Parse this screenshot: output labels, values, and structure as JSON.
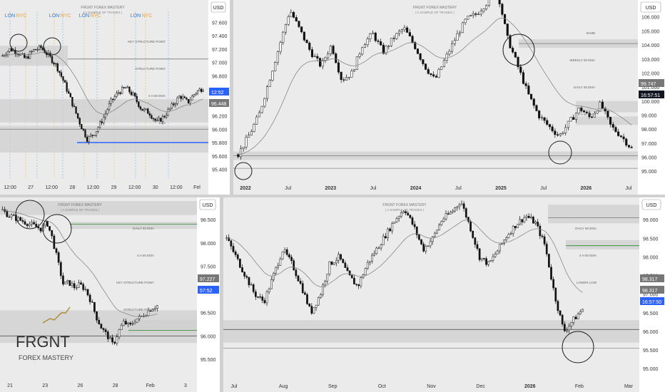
{
  "chart_data": [
    {
      "type": "candlestick",
      "currency": "USD",
      "yticks": [
        "97.600",
        "97.400",
        "97.200",
        "97.000",
        "96.800",
        "96.600",
        "96.400",
        "96.200",
        "96.000",
        "95.800",
        "95.600",
        "95.400"
      ],
      "xticks": [
        "12:00",
        "27",
        "12:00",
        "28",
        "12:00",
        "29",
        "12:00",
        "30",
        "12:00",
        "Fel"
      ],
      "session_labels": [
        [
          "LON",
          "NYC"
        ],
        [
          "LON",
          "NYC"
        ],
        [
          "LON",
          "NYC"
        ],
        [
          "LON",
          "NYC"
        ]
      ],
      "watermark": [
        "FRGNT FOREX MASTERY",
        "( A SAMPLE OF TRADES )"
      ],
      "annotations": [
        "KEY STRUCTURE POINT",
        "STRUCTURE POINT",
        "4 H 50 EMA",
        "ECS"
      ],
      "price_labels": [
        {
          "text": "12:52",
          "color": "#2962ff"
        },
        {
          "text": "96.448",
          "color": "#777777"
        }
      ],
      "series": [
        {
          "close": [
            97.1,
            97.2,
            97.15,
            97.05,
            97.18,
            97.22,
            97.1,
            96.95,
            96.7,
            96.4,
            96.1,
            95.85,
            95.95,
            96.15,
            96.4,
            96.55,
            96.62,
            96.5,
            96.3,
            96.25,
            96.1,
            96.2,
            96.35,
            96.5,
            96.4,
            96.55,
            96.62
          ]
        }
      ]
    },
    {
      "type": "candlestick",
      "currency": "USD",
      "yticks": [
        "106.000",
        "105.000",
        "104.000",
        "103.000",
        "102.000",
        "101.000",
        "100.000",
        "99.000",
        "98.000",
        "97.000",
        "96.000",
        "95.000"
      ],
      "xticks": [
        "2022",
        "Jul",
        "2023",
        "Jul",
        "2024",
        "Jul",
        "2025",
        "Jul",
        "2026",
        "Jul"
      ],
      "watermark": [
        "FRGNT FOREX MASTERY",
        "( A SAMPLE OF TRADES )"
      ],
      "annotations": [
        "W-MB",
        "WEEKLY 50 EMA",
        "DAILY 50 EMA",
        "4 H 50 EMA"
      ],
      "price_labels": [
        {
          "text": "99.747",
          "color": "#777777"
        },
        {
          "text": "16:57:51",
          "color": "#131722"
        }
      ],
      "series": [
        {
          "close": [
            96.2,
            97.5,
            99.0,
            101.5,
            104.0,
            106.5,
            105.0,
            103.5,
            102.5,
            104.0,
            101.5,
            102.0,
            104.0,
            104.8,
            103.5,
            104.5,
            105.2,
            104.0,
            102.5,
            101.5,
            103.0,
            104.5,
            105.8,
            106.2,
            107.0,
            108.0,
            104.5,
            102.5,
            100.5,
            99.0,
            98.2,
            97.5,
            98.5,
            99.5,
            98.8,
            99.8,
            98.2,
            97.5,
            96.6
          ]
        }
      ]
    },
    {
      "type": "candlestick",
      "currency": "USD",
      "yticks": [
        "98.500",
        "98.000",
        "97.500",
        "97.000",
        "96.500",
        "96.000",
        "95.500"
      ],
      "xticks": [
        "21",
        "23",
        "26",
        "28",
        "Feb",
        "3"
      ],
      "watermark": [
        "FRGNT FOREX MASTERY",
        "( A SAMPLE OF TRADES )"
      ],
      "annotations": [
        "DAILY 50 EMA",
        "4 H 50 EMA",
        "KEY STRUCTURE POINT",
        "STRUCTURE POINT"
      ],
      "logo": {
        "name": "FRGNT",
        "tagline": "FOREX MASTERY"
      },
      "price_labels": [
        {
          "text": "97.227",
          "color": "#777777"
        },
        {
          "text": "57:52",
          "color": "#2962ff"
        }
      ],
      "series": [
        {
          "close": [
            98.7,
            98.6,
            98.55,
            98.5,
            98.45,
            98.4,
            98.35,
            98.3,
            98.45,
            98.1,
            97.6,
            97.1,
            97.15,
            97.05,
            97.1,
            97.0,
            96.75,
            96.4,
            96.15,
            96.0,
            95.8,
            96.1,
            96.3,
            96.2,
            96.35,
            96.4,
            96.5,
            96.6,
            96.65
          ]
        }
      ]
    },
    {
      "type": "candlestick",
      "currency": "USD",
      "yticks": [
        "99.000",
        "98.500",
        "98.000",
        "97.500",
        "97.000",
        "96.500",
        "96.000",
        "95.500",
        "95.000"
      ],
      "xticks": [
        "Jul",
        "Aug",
        "Sep",
        "Oct",
        "Nov",
        "Dec",
        "2026",
        "Feb",
        "Mar"
      ],
      "watermark": [
        "FRGNT FOREX MASTERY",
        "( A SAMPLE OF TRADES )"
      ],
      "annotations": [
        "DAILY 50 EMA",
        "4 H 50 EMA",
        "LOWER LOW"
      ],
      "price_labels": [
        {
          "text": "98.317",
          "color": "#777777"
        },
        {
          "text": "98.317",
          "color": "#777777"
        },
        {
          "text": "16:57:50",
          "color": "#2962ff"
        }
      ],
      "series": [
        {
          "close": [
            98.5,
            98.0,
            97.5,
            97.0,
            96.8,
            97.5,
            98.2,
            97.8,
            97.2,
            96.5,
            97.0,
            97.8,
            98.0,
            97.5,
            97.2,
            97.8,
            98.2,
            98.6,
            99.0,
            99.3,
            98.8,
            98.2,
            98.5,
            99.0,
            99.2,
            99.5,
            98.8,
            98.0,
            97.8,
            98.2,
            98.6,
            98.9,
            99.1,
            98.9,
            98.3,
            97.0,
            96.0,
            96.3,
            96.6
          ]
        }
      ]
    }
  ]
}
